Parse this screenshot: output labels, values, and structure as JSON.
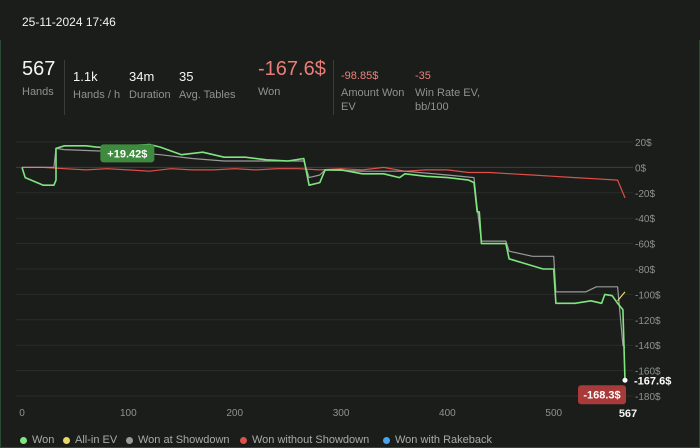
{
  "header": {
    "datetime": "25-11-2024 17:46"
  },
  "stats": [
    {
      "value": "567",
      "label": "Hands"
    },
    {
      "value": "1.1k",
      "label": "Hands / h"
    },
    {
      "value": "34m",
      "label": "Duration"
    },
    {
      "value": "35",
      "label": "Avg. Tables"
    },
    {
      "value": "-167.6$",
      "label": "Won"
    },
    {
      "value": "-98.85$",
      "label": "Amount Won EV"
    },
    {
      "value": "-35",
      "label": "Win Rate EV, bb/100"
    }
  ],
  "colors": {
    "won": "#7fe67f",
    "all_in_ev": "#e8d86a",
    "showdown": "#9a9a9a",
    "non_showdown": "#e0504a",
    "rakeback": "#4aa3e8",
    "label_green": "#3e8a3e",
    "label_red": "#a83a3a"
  },
  "chart_data": {
    "type": "line",
    "x_ticks": [
      "0",
      "100",
      "200",
      "300",
      "400",
      "500"
    ],
    "x_end_label": "567",
    "xlim": [
      0,
      567
    ],
    "y_ticks": [
      "20$",
      "0$",
      "-20$",
      "-40$",
      "-60$",
      "-80$",
      "-100$",
      "-120$",
      "-140$",
      "-160$",
      "-180$"
    ],
    "ylim": [
      -180,
      20
    ],
    "max_label": "+19.42$",
    "min_label": "-168.3$",
    "end_label": "-167.6$",
    "legend_position": "bottom",
    "series": [
      {
        "name": "Won",
        "key": "won",
        "points": [
          [
            0,
            0
          ],
          [
            3,
            -8
          ],
          [
            20,
            -14
          ],
          [
            30,
            -14
          ],
          [
            32,
            -10
          ],
          [
            32,
            15
          ],
          [
            40,
            17
          ],
          [
            60,
            17
          ],
          [
            70,
            16
          ],
          [
            90,
            15
          ],
          [
            100,
            17
          ],
          [
            120,
            18
          ],
          [
            130,
            16
          ],
          [
            150,
            10
          ],
          [
            170,
            12
          ],
          [
            190,
            8
          ],
          [
            210,
            8
          ],
          [
            230,
            6
          ],
          [
            250,
            5
          ],
          [
            265,
            7
          ],
          [
            270,
            -14
          ],
          [
            280,
            -12
          ],
          [
            285,
            -2
          ],
          [
            300,
            -2
          ],
          [
            320,
            -5
          ],
          [
            340,
            -5
          ],
          [
            355,
            -8
          ],
          [
            360,
            -5
          ],
          [
            380,
            -7
          ],
          [
            400,
            -8
          ],
          [
            420,
            -10
          ],
          [
            425,
            -12
          ],
          [
            428,
            -35
          ],
          [
            430,
            -35
          ],
          [
            432,
            -60
          ],
          [
            455,
            -60
          ],
          [
            458,
            -72
          ],
          [
            470,
            -75
          ],
          [
            490,
            -80
          ],
          [
            500,
            -80
          ],
          [
            502,
            -107
          ],
          [
            520,
            -107
          ],
          [
            535,
            -105
          ],
          [
            545,
            -107
          ],
          [
            548,
            -100
          ],
          [
            555,
            -101
          ],
          [
            560,
            -107
          ],
          [
            565,
            -112
          ],
          [
            567,
            -168
          ]
        ]
      },
      {
        "name": "All-in EV",
        "key": "all_in_ev",
        "points": [
          [
            560,
            -105
          ],
          [
            565,
            -100
          ],
          [
            567,
            -98
          ]
        ]
      },
      {
        "name": "Won at Showdown",
        "key": "showdown",
        "points": [
          [
            0,
            0
          ],
          [
            30,
            0
          ],
          [
            32,
            15
          ],
          [
            40,
            14
          ],
          [
            70,
            13
          ],
          [
            100,
            12
          ],
          [
            130,
            10
          ],
          [
            160,
            7
          ],
          [
            190,
            5
          ],
          [
            230,
            5
          ],
          [
            265,
            5
          ],
          [
            270,
            -8
          ],
          [
            280,
            -6
          ],
          [
            285,
            -2
          ],
          [
            320,
            -3
          ],
          [
            360,
            -3
          ],
          [
            400,
            -6
          ],
          [
            425,
            -8
          ],
          [
            428,
            -32
          ],
          [
            432,
            -58
          ],
          [
            455,
            -58
          ],
          [
            458,
            -66
          ],
          [
            480,
            -70
          ],
          [
            500,
            -70
          ],
          [
            502,
            -98
          ],
          [
            530,
            -98
          ],
          [
            540,
            -94
          ],
          [
            560,
            -94
          ],
          [
            565,
            -140
          ],
          [
            567,
            -142
          ]
        ]
      },
      {
        "name": "Won without Showdown",
        "key": "non_showdown",
        "points": [
          [
            0,
            0
          ],
          [
            20,
            0
          ],
          [
            40,
            -1
          ],
          [
            60,
            -2
          ],
          [
            80,
            -1
          ],
          [
            100,
            -2
          ],
          [
            120,
            -3
          ],
          [
            140,
            -1
          ],
          [
            160,
            -2
          ],
          [
            180,
            -2
          ],
          [
            200,
            -1
          ],
          [
            220,
            -2
          ],
          [
            240,
            -1
          ],
          [
            260,
            -1
          ],
          [
            280,
            -2
          ],
          [
            300,
            -1
          ],
          [
            320,
            -2
          ],
          [
            340,
            0
          ],
          [
            360,
            -3
          ],
          [
            380,
            -2
          ],
          [
            400,
            -2
          ],
          [
            420,
            -4
          ],
          [
            440,
            -4
          ],
          [
            460,
            -5
          ],
          [
            480,
            -6
          ],
          [
            500,
            -7
          ],
          [
            520,
            -8
          ],
          [
            540,
            -9
          ],
          [
            560,
            -10
          ],
          [
            565,
            -20
          ],
          [
            567,
            -24
          ]
        ]
      },
      {
        "name": "Won with Rakeback",
        "key": "rakeback",
        "points": []
      }
    ]
  }
}
